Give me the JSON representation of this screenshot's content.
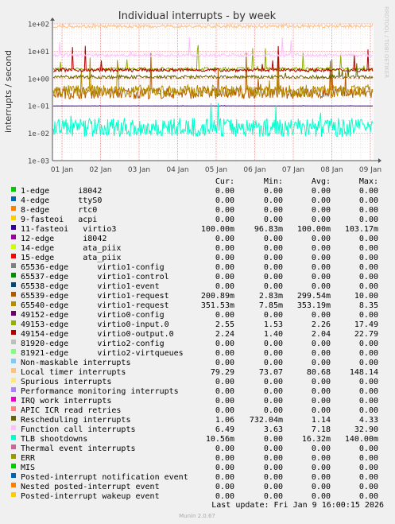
{
  "chart_data": {
    "type": "line",
    "title": "Individual interrupts - by week",
    "ylabel": "interrupts / second",
    "yscale": "log",
    "ylim": [
      0.001,
      100
    ],
    "y_ticks": [
      "1e-03",
      "1e-02",
      "1e-01",
      "1e+00",
      "1e+01",
      "1e+02"
    ],
    "x_ticks": [
      "01 Jan",
      "02 Jan",
      "03 Jan",
      "04 Jan",
      "05 Jan",
      "06 Jan",
      "07 Jan",
      "08 Jan",
      "09 Jan"
    ],
    "side_label": "RRDTOOL / TOBI OETIKER",
    "grid": true,
    "column_headers": [
      "Cur:",
      "Min:",
      "Avg:",
      "Max:"
    ],
    "series": [
      {
        "name": "1-edge      i8042",
        "color": "#00cc00",
        "cur": "0.00",
        "min": "0.00",
        "avg": "0.00",
        "max": "0.00"
      },
      {
        "name": "4-edge      ttyS0",
        "color": "#0066b3",
        "cur": "0.00",
        "min": "0.00",
        "avg": "0.00",
        "max": "0.00"
      },
      {
        "name": "8-edge      rtc0",
        "color": "#ff8000",
        "cur": "0.00",
        "min": "0.00",
        "avg": "0.00",
        "max": "0.00"
      },
      {
        "name": "9-fasteoi   acpi",
        "color": "#ffcc00",
        "cur": "0.00",
        "min": "0.00",
        "avg": "0.00",
        "max": "0.00"
      },
      {
        "name": "11-fasteoi   virtio3",
        "color": "#330099",
        "cur": "100.00m",
        "min": "96.83m",
        "avg": "100.00m",
        "max": "103.17m"
      },
      {
        "name": "12-edge      i8042",
        "color": "#990099",
        "cur": "0.00",
        "min": "0.00",
        "avg": "0.00",
        "max": "0.00"
      },
      {
        "name": "14-edge      ata_piix",
        "color": "#ccff00",
        "cur": "0.00",
        "min": "0.00",
        "avg": "0.00",
        "max": "0.00"
      },
      {
        "name": "15-edge      ata_piix",
        "color": "#ff0000",
        "cur": "0.00",
        "min": "0.00",
        "avg": "0.00",
        "max": "0.00"
      },
      {
        "name": "65536-edge      virtio1-config",
        "color": "#808080",
        "cur": "0.00",
        "min": "0.00",
        "avg": "0.00",
        "max": "0.00"
      },
      {
        "name": "65537-edge      virtio1-control",
        "color": "#008f00",
        "cur": "0.00",
        "min": "0.00",
        "avg": "0.00",
        "max": "0.00"
      },
      {
        "name": "65538-edge      virtio1-event",
        "color": "#00487d",
        "cur": "0.00",
        "min": "0.00",
        "avg": "0.00",
        "max": "0.00"
      },
      {
        "name": "65539-edge      virtio1-request",
        "color": "#b35a00",
        "cur": "200.89m",
        "min": "2.83m",
        "avg": "299.54m",
        "max": "10.00"
      },
      {
        "name": "65540-edge      virtio1-request",
        "color": "#b38f00",
        "cur": "351.53m",
        "min": "7.85m",
        "avg": "353.19m",
        "max": "8.35"
      },
      {
        "name": "49152-edge      virtio0-config",
        "color": "#6b006b",
        "cur": "0.00",
        "min": "0.00",
        "avg": "0.00",
        "max": "0.00"
      },
      {
        "name": "49153-edge      virtio0-input.0",
        "color": "#8fb300",
        "cur": "2.55",
        "min": "1.53",
        "avg": "2.26",
        "max": "17.49"
      },
      {
        "name": "49154-edge      virtio0-output.0",
        "color": "#b30000",
        "cur": "2.24",
        "min": "1.40",
        "avg": "2.04",
        "max": "22.79"
      },
      {
        "name": "81920-edge      virtio2-config",
        "color": "#bebebe",
        "cur": "0.00",
        "min": "0.00",
        "avg": "0.00",
        "max": "0.00"
      },
      {
        "name": "81921-edge      virtio2-virtqueues",
        "color": "#80ff80",
        "cur": "0.00",
        "min": "0.00",
        "avg": "0.00",
        "max": "0.00"
      },
      {
        "name": "Non-maskable interrupts",
        "color": "#80c9ff",
        "cur": "0.00",
        "min": "0.00",
        "avg": "0.00",
        "max": "0.00"
      },
      {
        "name": "Local timer interrupts",
        "color": "#ffc080",
        "cur": "79.29",
        "min": "73.07",
        "avg": "80.68",
        "max": "148.14"
      },
      {
        "name": "Spurious interrupts",
        "color": "#ffe680",
        "cur": "0.00",
        "min": "0.00",
        "avg": "0.00",
        "max": "0.00"
      },
      {
        "name": "Performance monitoring interrupts",
        "color": "#aa80ff",
        "cur": "0.00",
        "min": "0.00",
        "avg": "0.00",
        "max": "0.00"
      },
      {
        "name": "IRQ work interrupts",
        "color": "#ee00cc",
        "cur": "0.00",
        "min": "0.00",
        "avg": "0.00",
        "max": "0.00"
      },
      {
        "name": "APIC ICR read retries",
        "color": "#ff8080",
        "cur": "0.00",
        "min": "0.00",
        "avg": "0.00",
        "max": "0.00"
      },
      {
        "name": "Rescheduling interrupts",
        "color": "#666600",
        "cur": "1.06",
        "min": "732.04m",
        "avg": "1.14",
        "max": "4.33"
      },
      {
        "name": "Function call interrupts",
        "color": "#ffbfff",
        "cur": "6.49",
        "min": "3.63",
        "avg": "7.18",
        "max": "32.90"
      },
      {
        "name": "TLB shootdowns",
        "color": "#00ffcc",
        "cur": "10.56m",
        "min": "0.00",
        "avg": "16.32m",
        "max": "140.00m"
      },
      {
        "name": "Thermal event interrupts",
        "color": "#cc6699",
        "cur": "0.00",
        "min": "0.00",
        "avg": "0.00",
        "max": "0.00"
      },
      {
        "name": "ERR",
        "color": "#999900",
        "cur": "0.00",
        "min": "0.00",
        "avg": "0.00",
        "max": "0.00"
      },
      {
        "name": "MIS",
        "color": "#00cc00",
        "cur": "0.00",
        "min": "0.00",
        "avg": "0.00",
        "max": "0.00"
      },
      {
        "name": "Posted-interrupt notification event",
        "color": "#0066b3",
        "cur": "0.00",
        "min": "0.00",
        "avg": "0.00",
        "max": "0.00"
      },
      {
        "name": "Nested posted-interrupt event",
        "color": "#ff8000",
        "cur": "0.00",
        "min": "0.00",
        "avg": "0.00",
        "max": "0.00"
      },
      {
        "name": "Posted-interrupt wakeup event",
        "color": "#ffcc00",
        "cur": "0.00",
        "min": "0.00",
        "avg": "0.00",
        "max": "0.00"
      }
    ],
    "last_update": "Last update: Fri Jan  9 16:00:15 2026",
    "footer": "Munin 2.0.67"
  }
}
